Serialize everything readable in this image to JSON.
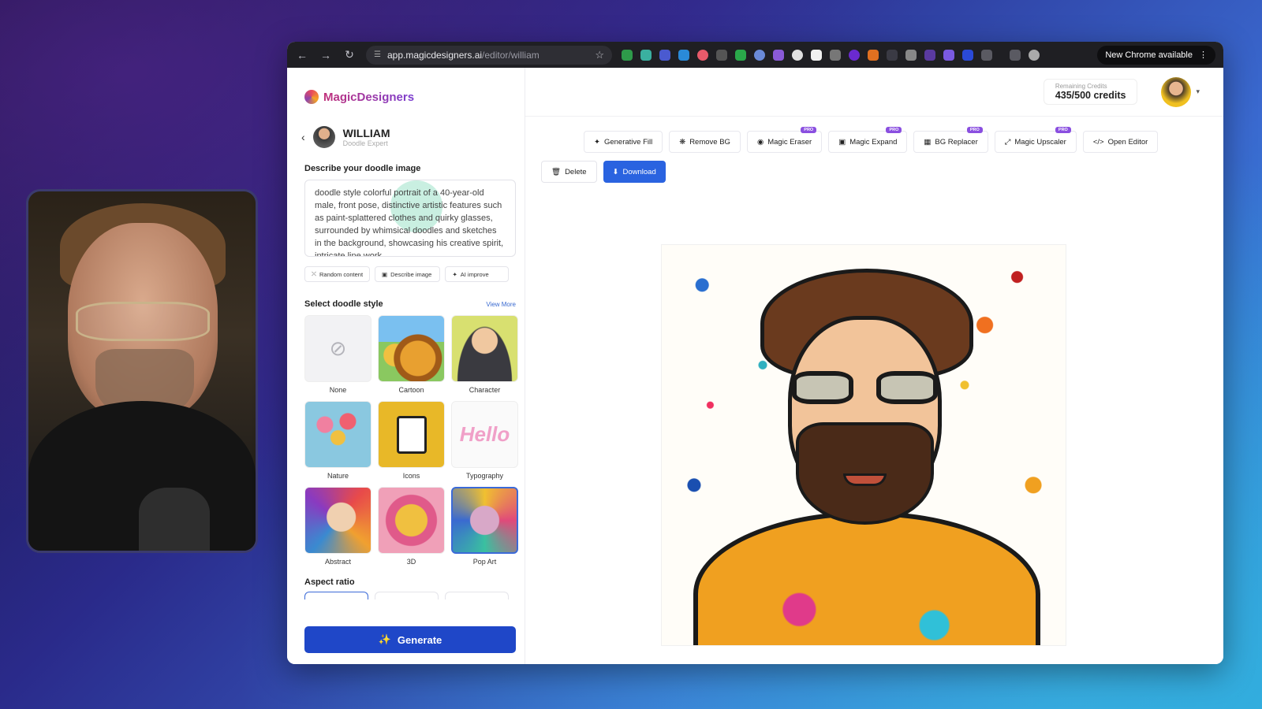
{
  "browser": {
    "url_host": "app.magicdesigners.ai",
    "url_path": "/editor/william",
    "new_chrome_label": "New Chrome available"
  },
  "sidebar": {
    "brand": "MagicDesigners",
    "agent": {
      "name": "WILLIAM",
      "role": "Doodle Expert"
    },
    "describe_title": "Describe your doodle image",
    "prompt_text": "doodle style colorful portrait of a 40-year-old male, front pose, distinctive artistic features such as paint-splattered clothes and quirky glasses, surrounded by whimsical doodles and sketches in the background, showcasing his creative spirit, intricate line work",
    "prompt_actions": [
      "Random content",
      "Describe image",
      "AI improve"
    ],
    "style_title": "Select doodle style",
    "view_more": "View More",
    "styles": [
      {
        "label": "None",
        "selected": false
      },
      {
        "label": "Cartoon",
        "selected": false
      },
      {
        "label": "Character",
        "selected": false
      },
      {
        "label": "Nature",
        "selected": false
      },
      {
        "label": "Icons",
        "selected": false
      },
      {
        "label": "Typography",
        "selected": false
      },
      {
        "label": "Abstract",
        "selected": false
      },
      {
        "label": "3D",
        "selected": false
      },
      {
        "label": "Pop Art",
        "selected": true
      }
    ],
    "typography_thumb_text": "Hello",
    "aspect_title": "Aspect ratio",
    "generate_label": "Generate"
  },
  "header": {
    "credits_label": "Remaining Credits",
    "credits_value": "435/500 credits"
  },
  "toolbar": {
    "tools": [
      {
        "label": "Generative Fill",
        "pro": false,
        "icon": "wand-icon"
      },
      {
        "label": "Remove BG",
        "pro": false,
        "icon": "remove-bg-icon"
      },
      {
        "label": "Magic Eraser",
        "pro": true,
        "icon": "eraser-icon"
      },
      {
        "label": "Magic Expand",
        "pro": true,
        "icon": "expand-icon"
      },
      {
        "label": "BG Replacer",
        "pro": true,
        "icon": "bg-replace-icon"
      },
      {
        "label": "Magic Upscaler",
        "pro": true,
        "icon": "upscale-icon"
      },
      {
        "label": "Open Editor",
        "pro": false,
        "icon": "code-icon"
      }
    ],
    "pro_badge": "PRO",
    "delete_label": "Delete",
    "download_label": "Download"
  },
  "colors": {
    "accent": "#2a63e0",
    "generate": "#1f47c8",
    "pro": "#8a4fe0"
  }
}
